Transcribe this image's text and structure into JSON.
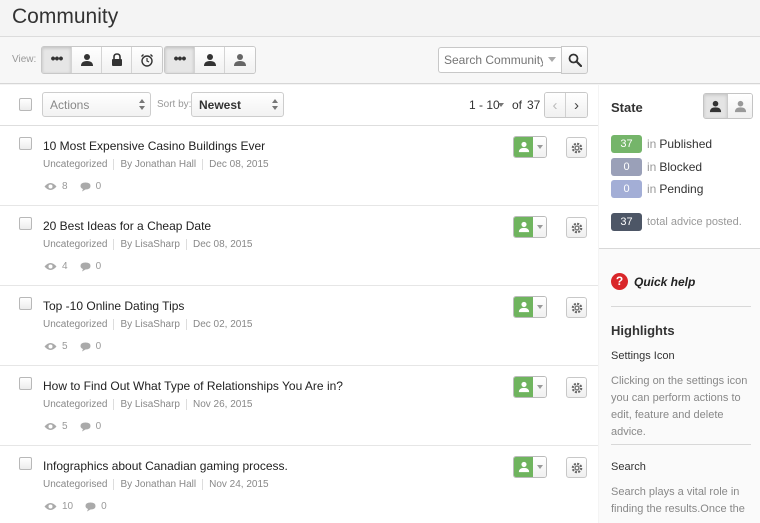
{
  "app": {
    "title": "Community"
  },
  "viewbar": {
    "label": "View:",
    "group1": [
      {
        "icon": "more-dots-icon",
        "active": true
      },
      {
        "icon": "user-icon"
      },
      {
        "icon": "lock-icon"
      },
      {
        "icon": "alarm-clock-icon"
      }
    ],
    "group2": [
      {
        "icon": "more-dots-icon",
        "active": true
      },
      {
        "icon": "user-icon"
      },
      {
        "icon": "user-silhouette-icon"
      }
    ],
    "search": {
      "placeholder": "Search Community",
      "value": ""
    }
  },
  "toolbar": {
    "actions_label": "Actions",
    "sortby_label": "Sort by:",
    "sort_value": "Newest",
    "pager": {
      "range": "1 - 10",
      "of": "of",
      "total": "37"
    }
  },
  "items": [
    {
      "title": "10 Most Expensive Casino Buildings Ever",
      "category": "Uncategorized",
      "author": "By Jonathan Hall",
      "date": "Dec 08, 2015",
      "views": "8",
      "comments": "0"
    },
    {
      "title": "20 Best Ideas for a Cheap Date",
      "category": "Uncategorized",
      "author": "By LisaSharp",
      "date": "Dec 08, 2015",
      "views": "4",
      "comments": "0"
    },
    {
      "title": "Top -10 Online Dating Tips",
      "category": "Uncategorized",
      "author": "By LisaSharp",
      "date": "Dec 02, 2015",
      "views": "5",
      "comments": "0"
    },
    {
      "title": "How to Find Out What Type of Relationships You Are in?",
      "category": "Uncategorized",
      "author": "By LisaSharp",
      "date": "Nov 26, 2015",
      "views": "5",
      "comments": "0"
    },
    {
      "title": "Infographics about Canadian gaming process.",
      "category": "Uncategorised",
      "author": "By Jonathan Hall",
      "date": "Nov 24, 2015",
      "views": "10",
      "comments": "0"
    }
  ],
  "state": {
    "title": "State",
    "in_word": "in",
    "published": {
      "count": "37",
      "label": "Published",
      "color": "#75b56a"
    },
    "blocked": {
      "count": "0",
      "label": "Blocked",
      "color": "#9aa0b8"
    },
    "pending": {
      "count": "0",
      "label": "Pending",
      "color": "#a3aed6"
    },
    "total": {
      "count": "37",
      "label": "total advice posted.",
      "color": "#4d5666"
    }
  },
  "help": {
    "quick_help": "Quick help",
    "highlights_title": "Highlights",
    "settings_title": "Settings Icon",
    "settings_text": "Clicking on the settings icon you can perform actions to edit, feature and delete advice.",
    "search_title": "Search",
    "search_text": "Search plays a vital role in finding the results.Once the"
  }
}
